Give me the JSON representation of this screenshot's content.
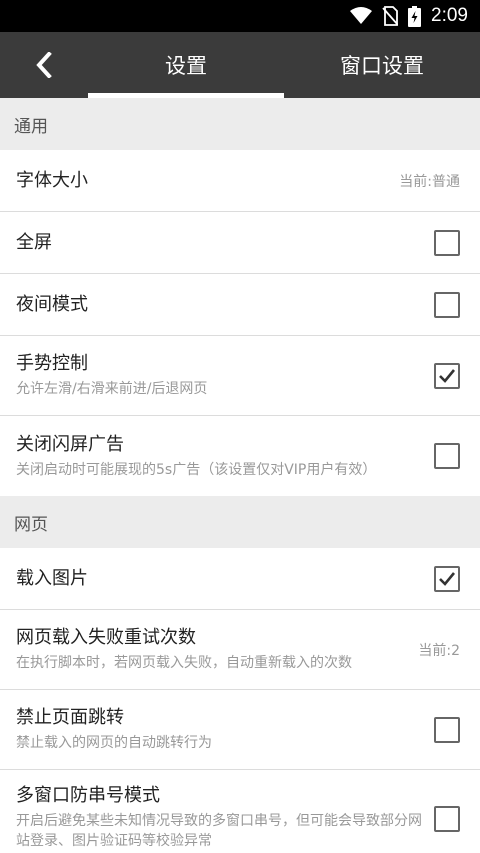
{
  "status_bar": {
    "time": "2:09"
  },
  "toolbar": {
    "tabs": [
      {
        "label": "设置",
        "active": true
      },
      {
        "label": "窗口设置",
        "active": false
      }
    ]
  },
  "sections": [
    {
      "header": "通用",
      "items": [
        {
          "title": "字体大小",
          "value": "当前:普通"
        },
        {
          "title": "全屏",
          "checked": false
        },
        {
          "title": "夜间模式",
          "checked": false
        },
        {
          "title": "手势控制",
          "desc": "允许左滑/右滑来前进/后退网页",
          "checked": true
        },
        {
          "title": "关闭闪屏广告",
          "desc": "关闭启动时可能展现的5s广告（该设置仅对VIP用户有效）",
          "checked": false
        }
      ]
    },
    {
      "header": "网页",
      "items": [
        {
          "title": "载入图片",
          "checked": true
        },
        {
          "title": "网页载入失败重试次数",
          "desc": "在执行脚本时，若网页载入失败，自动重新载入的次数",
          "value": "当前:2"
        },
        {
          "title": "禁止页面跳转",
          "desc": "禁止载入的网页的自动跳转行为",
          "checked": false
        },
        {
          "title": "多窗口防串号模式",
          "desc": "开启后避免某些未知情况导致的多窗口串号，但可能会导致部分网站登录、图片验证码等校验异常",
          "checked": false
        }
      ]
    }
  ]
}
